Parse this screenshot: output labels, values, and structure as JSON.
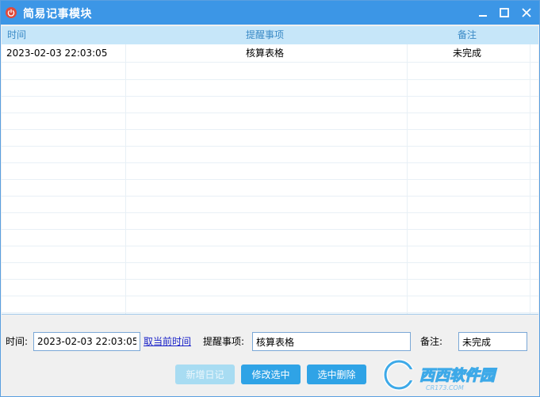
{
  "window": {
    "title": "简易记事模块",
    "icon": "power-icon"
  },
  "grid": {
    "headers": [
      "时间",
      "提醒事项",
      "备注"
    ],
    "rows": [
      [
        "2023-02-03 22:03:05",
        "核算表格",
        "未完成"
      ]
    ]
  },
  "form": {
    "time_label": "时间:",
    "time_value": "2023-02-03 22:03:05",
    "now_link": "取当前时间",
    "item_label": "提醒事项:",
    "item_value": "核算表格",
    "note_label": "备注:",
    "note_value": "未完成"
  },
  "buttons": {
    "add": "新增日记",
    "edit": "修改选中",
    "delete": "选中删除"
  },
  "watermark": {
    "text": "西西软件园",
    "sub": "CR173.COM"
  }
}
